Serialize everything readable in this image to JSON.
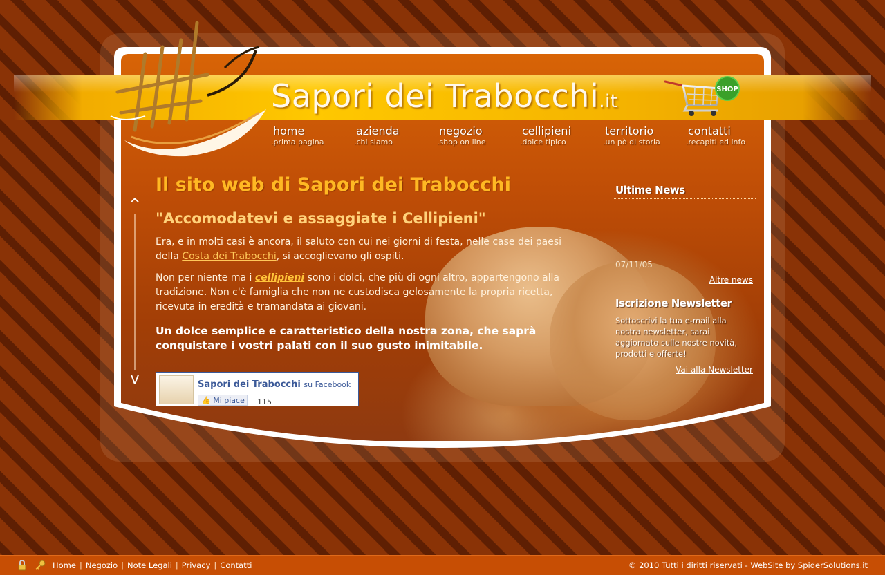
{
  "header": {
    "title_main": "Sapori dei Trabocchi",
    "title_tld": ".it",
    "shop_badge": "SHOP"
  },
  "nav": {
    "items": [
      {
        "label": "home",
        "sub": ".prima pagina"
      },
      {
        "label": "azienda",
        "sub": ".chi siamo"
      },
      {
        "label": "negozio",
        "sub": ".shop on line"
      },
      {
        "label": "cellipieni",
        "sub": ".dolce tipico"
      },
      {
        "label": "territorio",
        "sub": ".un pò di storia"
      },
      {
        "label": "contatti",
        "sub": ".recapiti ed info"
      }
    ]
  },
  "scroll": {
    "up": "^",
    "down": "v"
  },
  "main": {
    "title": "Il sito web di Sapori dei Trabocchi",
    "subtitle": "\"Accomodatevi e assaggiate i Cellipieni\"",
    "p1_before": "Era, e in molti casi è ancora, il saluto con cui nei giorni di festa, nelle case dei paesi della ",
    "p1_link": "Costa dei Trabocchi",
    "p1_after": ", si accoglievano gli ospiti.",
    "p2_before": "Non per niente ma i ",
    "p2_link": "cellipieni",
    "p2_after": " sono i dolci, che più di ogni altro, appartengono alla tradizione. Non c'è famiglia che non ne custodisca gelosamente la propria ricetta, ricevuta in eredità e tramandata ai giovani.",
    "highlight": "Un dolce semplice e caratteristico della nostra zona, che saprà conquistare i vostri palati con il suo gusto inimitabile."
  },
  "facebook": {
    "page_name": "Sapori dei Trabocchi",
    "on_label": "su Facebook",
    "like_label": "Mi piace",
    "like_count": "115"
  },
  "sidebar": {
    "news_heading": "Ultime News",
    "news_date": "07/11/05",
    "more_news": "Altre news",
    "newsletter_heading": "Iscrizione Newsletter",
    "newsletter_text": "Sottoscrivi la tua e-mail alla nostra newsletter, sarai aggiornato sulle nostre novità, prodotti e offerte!",
    "newsletter_link": "Vai alla Newsletter"
  },
  "footer": {
    "links": [
      "Home",
      "Negozio",
      "Note Legali",
      "Privacy",
      "Contatti"
    ],
    "separator": "|",
    "copyright": "© 2010 Tutti i diritti riservati - ",
    "credit_link": "WebSite by SpiderSolutions.it"
  },
  "icons": {
    "logo": "trabocco-logo-icon",
    "cart": "shopping-cart-icon",
    "lock": "lock-icon",
    "key": "key-icon"
  },
  "colors": {
    "background_stripe_light": "#8a3306",
    "background_stripe_dark": "#5e1f03",
    "banner_yellow": "#ffc800",
    "panel_orange": "#d86406",
    "title_gold": "#ffb823",
    "footer_orange": "#c74e04",
    "facebook_blue": "#3b5998"
  }
}
